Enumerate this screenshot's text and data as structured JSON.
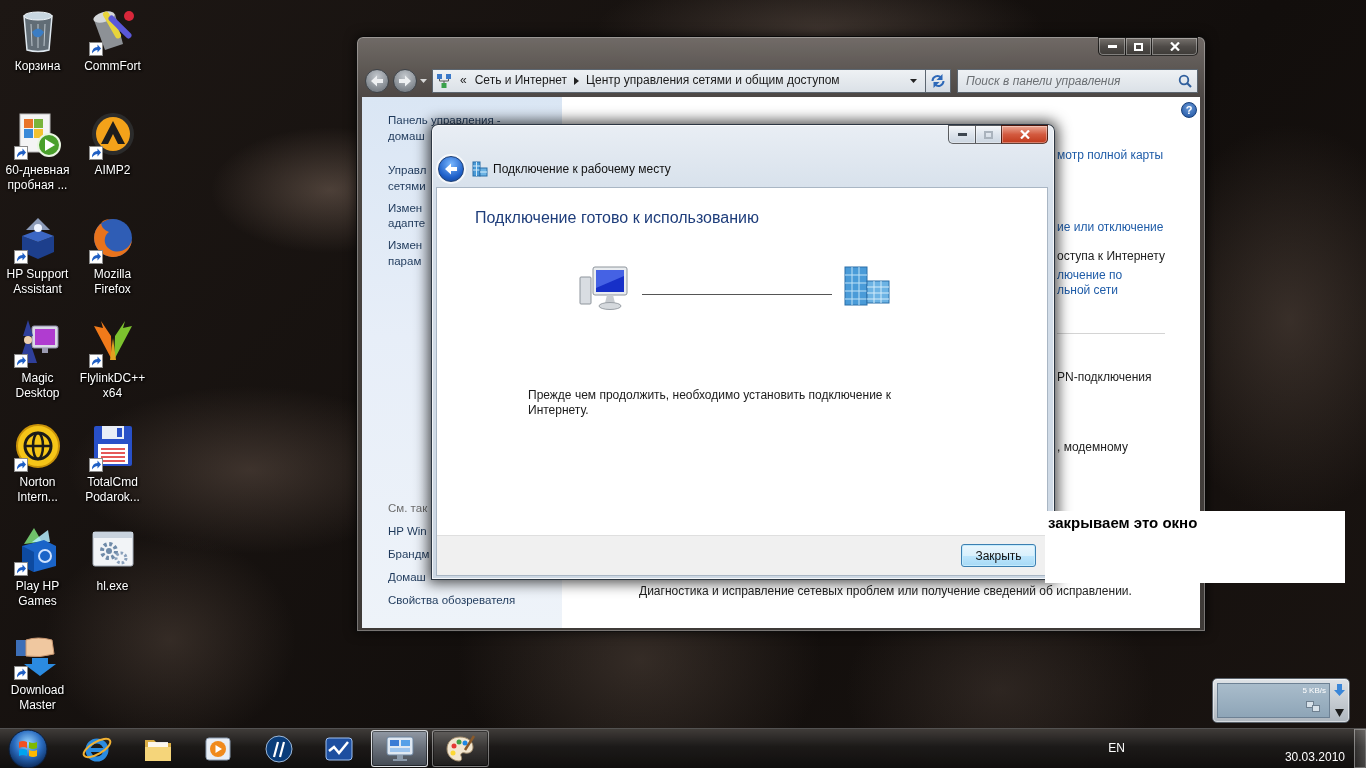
{
  "desktop_icons": [
    {
      "label": "Корзина",
      "kind": "trash",
      "shortcut": false
    },
    {
      "label": "CommFort",
      "kind": "bucket",
      "shortcut": true
    },
    {
      "label": "60-дневная пробная ...",
      "kind": "trial",
      "shortcut": true
    },
    {
      "label": "AIMP2",
      "kind": "disc",
      "shortcut": true
    },
    {
      "label": "HP Support Assistant",
      "kind": "box",
      "shortcut": true
    },
    {
      "label": "Mozilla Firefox",
      "kind": "browser",
      "shortcut": true
    },
    {
      "label": "Magic Desktop",
      "kind": "wizard",
      "shortcut": true
    },
    {
      "label": "FlylinkDC++ x64",
      "kind": "wings",
      "shortcut": true
    },
    {
      "label": "Norton Intern...",
      "kind": "globe",
      "shortcut": true
    },
    {
      "label": "TotalCmd Podarok...",
      "kind": "floppy",
      "shortcut": true
    },
    {
      "label": "Play HP Games",
      "kind": "games",
      "shortcut": true
    },
    {
      "label": "hl.exe",
      "kind": "exe",
      "shortcut": false
    },
    {
      "label": "Download Master",
      "kind": "download",
      "shortcut": true
    }
  ],
  "control_panel": {
    "active": false,
    "caption_buttons": [
      {
        "kind": "minimize"
      },
      {
        "kind": "maximize"
      },
      {
        "kind": "close"
      }
    ],
    "nav_buttons": [
      {
        "kind": "back",
        "disabled": true
      },
      {
        "kind": "forward",
        "disabled": true
      }
    ],
    "address": {
      "overflow": "«",
      "crumbs": [
        "Сеть и Интернет",
        "Центр управления сетями и общим доступом"
      ]
    },
    "search": {
      "placeholder": "Поиск в панели управления"
    },
    "help_button": "?",
    "sidebar": {
      "links": [
        {
          "lines": [
            "Панель управления -",
            "домаш"
          ]
        },
        {
          "lines": [
            "Управл",
            "сетями"
          ]
        },
        {
          "lines": [
            "Измен",
            "адапте"
          ]
        },
        {
          "lines": [
            "Измен",
            "парам"
          ]
        }
      ],
      "see_also": {
        "heading": "См. так",
        "links": [
          "HP Win",
          "Брандм",
          "Домаш",
          "Свойства обозревателя"
        ]
      }
    },
    "content": [
      {
        "kind": "link",
        "lines": [
          "мотр полной карты"
        ]
      },
      {
        "kind": "link",
        "lines": [
          "ие или отключение"
        ]
      },
      {
        "kind": "text",
        "lines": [
          "оступа к Интернету"
        ]
      },
      {
        "kind": "link",
        "lines": [
          "лючение по",
          "льной сети"
        ]
      },
      {
        "kind": "rule"
      },
      {
        "kind": "text",
        "lines": [
          "PN-подключения"
        ]
      },
      {
        "kind": "text",
        "lines": [
          ", модемному"
        ]
      }
    ],
    "footer_text": "Диагностика и исправление сетевых проблем или получение сведений об исправлении."
  },
  "dialog": {
    "active": true,
    "caption_buttons": [
      {
        "kind": "minimize",
        "disabled": false
      },
      {
        "kind": "maximize",
        "disabled": true
      },
      {
        "kind": "close",
        "disabled": false
      }
    ],
    "back_button": {
      "disabled": false
    },
    "title": "Подключение к рабочему месту",
    "heading": "Подключение готово к использованию",
    "message": "Прежде чем продолжить, необходимо установить подключение к Интернету.",
    "buttons": [
      {
        "label": "Закрыть",
        "default": true
      }
    ]
  },
  "annotation": {
    "text": "закрываем это окно"
  },
  "net_meter": {
    "speed": "5 KB/s"
  },
  "taskbar": {
    "items": [
      {
        "kind": "browser",
        "open": false,
        "active": false
      },
      {
        "kind": "folder",
        "open": false,
        "active": false
      },
      {
        "kind": "media",
        "open": false,
        "active": false
      },
      {
        "kind": "logo",
        "open": false,
        "active": false
      },
      {
        "kind": "wave",
        "open": false,
        "active": false
      },
      {
        "kind": "panel",
        "open": true,
        "active": true
      },
      {
        "kind": "paint",
        "open": true,
        "active": false
      }
    ],
    "tray": {
      "language": "EN",
      "date": "30.03.2010"
    }
  }
}
